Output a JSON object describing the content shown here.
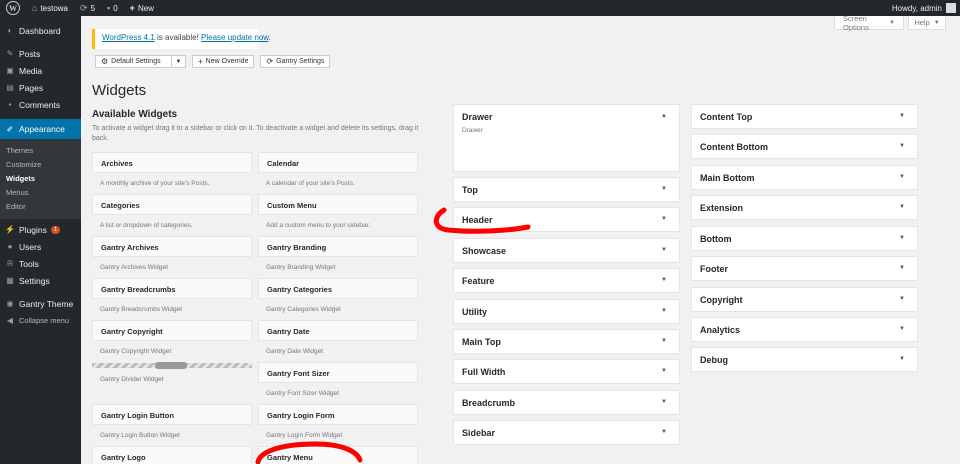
{
  "adminbar": {
    "site_name": "testowa",
    "updates_count": "5",
    "comments_count": "0",
    "new_label": "New",
    "howdy": "Howdy, admin"
  },
  "menu": {
    "dashboard": "Dashboard",
    "posts": "Posts",
    "media": "Media",
    "pages": "Pages",
    "comments": "Comments",
    "appearance": "Appearance",
    "sub": [
      "Themes",
      "Customize",
      "Widgets",
      "Menus",
      "Editor"
    ],
    "plugins": "Plugins",
    "plugins_badge": "1",
    "users": "Users",
    "tools": "Tools",
    "settings": "Settings",
    "gantry_theme": "Gantry Theme",
    "collapse": "Collapse menu"
  },
  "screen_tabs": {
    "screen_options": "Screen Options",
    "help": "Help"
  },
  "notice": {
    "link_version": "WordPress 4.1",
    "middle": " is available! ",
    "link_update": "Please update now",
    "end": "."
  },
  "toolbar": {
    "default_settings": "Default Settings",
    "new_override": "New Override",
    "gantry_settings": "Gantry Settings"
  },
  "page_title": "Widgets",
  "available": {
    "title": "Available Widgets",
    "description": "To activate a widget drag it to a sidebar or click on it. To deactivate a widget and delete its settings, drag it back."
  },
  "widgets_left": [
    {
      "name": "Archives",
      "desc": "A monthly archive of your site’s Posts."
    },
    {
      "name": "Categories",
      "desc": "A list or dropdown of categories."
    },
    {
      "name": "Gantry Archives",
      "desc": "Gantry Archives Widget"
    },
    {
      "name": "Gantry Breadcrumbs",
      "desc": "Gantry Breadcrumbs Widget"
    },
    {
      "name": "Gantry Copyright",
      "desc": "Gantry Copyright Widget"
    },
    {
      "name": "",
      "desc": "Gantry Divider Widget"
    },
    {
      "name": "Gantry Login Button",
      "desc": "Gantry Login Button Widget"
    },
    {
      "name": "Gantry Logo",
      "desc": ""
    }
  ],
  "widgets_right": [
    {
      "name": "Calendar",
      "desc": "A calendar of your site’s Posts."
    },
    {
      "name": "Custom Menu",
      "desc": "Add a custom menu to your sidebar."
    },
    {
      "name": "Gantry Branding",
      "desc": "Gantry Branding Widget"
    },
    {
      "name": "Gantry Categories",
      "desc": "Gantry Categories Widget"
    },
    {
      "name": "Gantry Date",
      "desc": "Gantry Date Widget"
    },
    {
      "name": "Gantry Font Sizer",
      "desc": "Gantry Font Sizer Widget"
    },
    {
      "name": "Gantry Login Form",
      "desc": "Gantry Login Form Widget"
    },
    {
      "name": "Gantry Menu",
      "desc": ""
    }
  ],
  "sidebars_col1": [
    {
      "name": "Drawer",
      "desc": "Drawer",
      "open": true
    },
    {
      "name": "Top"
    },
    {
      "name": "Header"
    },
    {
      "name": "Showcase"
    },
    {
      "name": "Feature"
    },
    {
      "name": "Utility"
    },
    {
      "name": "Main Top"
    },
    {
      "name": "Full Width"
    },
    {
      "name": "Breadcrumb"
    },
    {
      "name": "Sidebar"
    }
  ],
  "sidebars_col2": [
    {
      "name": "Content Top"
    },
    {
      "name": "Content Bottom"
    },
    {
      "name": "Main Bottom"
    },
    {
      "name": "Extension"
    },
    {
      "name": "Bottom"
    },
    {
      "name": "Footer"
    },
    {
      "name": "Copyright"
    },
    {
      "name": "Analytics"
    },
    {
      "name": "Debug"
    }
  ],
  "colors": {
    "accent": "#0073aa",
    "adminbar": "#23282d",
    "annotation": "#ff0000",
    "notice_border": "#ffba00"
  }
}
